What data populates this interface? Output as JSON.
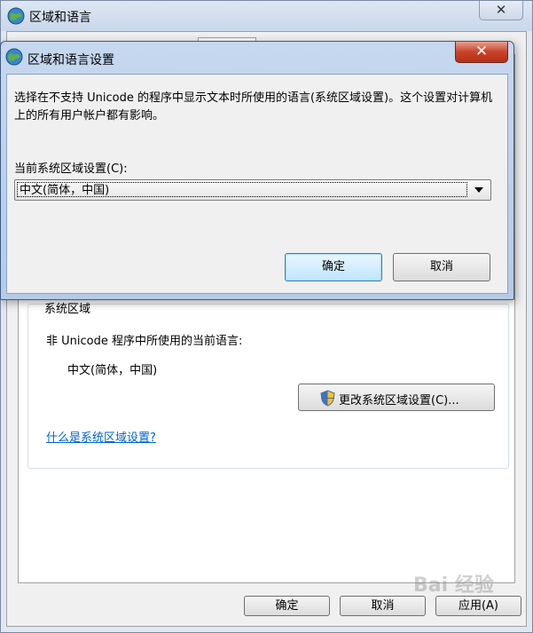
{
  "parent": {
    "title": "区域和语言",
    "close_glyph": "✕",
    "group_partial_text": "系统区域",
    "nonunicode_label": "非 Unicode 程序中所使用的当前语言:",
    "nonunicode_value": "中文(简体，中国)",
    "change_button_label": "更改系统区域设置(C)...",
    "what_link": "什么是系统区域设置?",
    "buttons": {
      "ok": "确定",
      "cancel": "取消",
      "apply": "应用(A)"
    }
  },
  "dialog": {
    "title": "区域和语言设置",
    "close_glyph": "✕",
    "description": "选择在不支持 Unicode 的程序中显示文本时所使用的语言(系统区域设置)。这个设置对计算机上的所有用户帐户都有影响。",
    "current_label": "当前系统区域设置(C):",
    "current_value": "中文(简体，中国)",
    "ok": "确定",
    "cancel": "取消"
  },
  "watermark": "Bai 经验",
  "colors": {
    "link": "#0066cc",
    "close_red": "#c7432a",
    "titlebar": "#c6d8ef",
    "default_button_border": "#3c7fb1"
  },
  "icons": [
    "globe-icon",
    "close-icon",
    "shield-icon",
    "dropdown-arrow-icon"
  ]
}
